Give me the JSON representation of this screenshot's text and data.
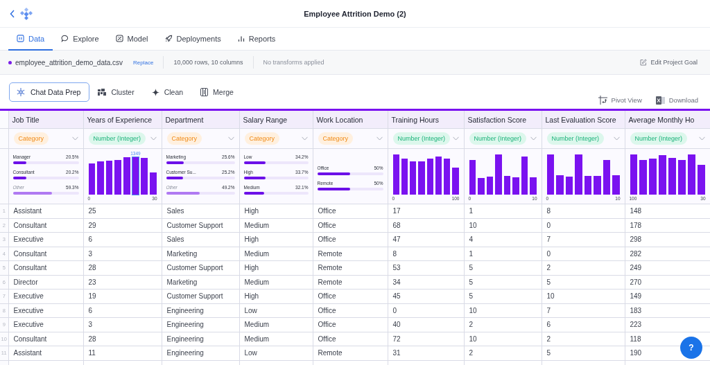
{
  "app": {
    "title": "Employee Attrition Demo (2)"
  },
  "tabs": [
    {
      "label": "Data",
      "kind": "data",
      "selected": true
    },
    {
      "label": "Explore",
      "kind": "chat",
      "selected": false
    },
    {
      "label": "Model",
      "kind": "model",
      "selected": false
    },
    {
      "label": "Deployments",
      "kind": "rocket",
      "selected": false
    },
    {
      "label": "Reports",
      "kind": "bars",
      "selected": false
    }
  ],
  "file_bar": {
    "file_name": "employee_attrition_demo_data.csv",
    "replace_link": "Replace",
    "stats": "10,000 rows, 10 columns",
    "transforms": "No transforms applied",
    "edit_goal": "Edit Project Goal"
  },
  "toolbar": {
    "left": [
      {
        "label": "Chat Data Prep",
        "kind": "snowflake",
        "selected": true
      },
      {
        "label": "Cluster",
        "kind": "cluster",
        "selected": false
      },
      {
        "label": "Clean",
        "kind": "sparkle",
        "selected": false
      },
      {
        "label": "Merge",
        "kind": "merge",
        "selected": false
      }
    ],
    "right": [
      {
        "label": "Pivot View",
        "kind": "pivot"
      },
      {
        "label": "Download",
        "kind": "sheet"
      }
    ]
  },
  "table": {
    "columns": [
      {
        "name": "Job Title",
        "type": {
          "kind": "category",
          "label": "Category"
        },
        "summary": {
          "kind": "category",
          "items": [
            {
              "label": "Manager",
              "percent": "20.5%",
              "level": 0.205,
              "kind": "value"
            },
            {
              "label": "Consultant",
              "percent": "20.2%",
              "level": 0.202,
              "kind": "value"
            },
            {
              "label": "Other",
              "percent": "59.3%",
              "level": 0.593,
              "kind": "other"
            }
          ]
        }
      },
      {
        "name": "Years of Experience",
        "type": {
          "kind": "number",
          "label": "Number (Integer)"
        },
        "summary": {
          "kind": "histogram",
          "min_label": "0",
          "max_label": "30",
          "tooltip": "1349",
          "bars": [
            {
              "selected": false
            },
            {
              "selected": false
            },
            {
              "selected": false
            },
            {
              "selected": false
            },
            {
              "selected": false
            },
            {
              "selected": true
            },
            {
              "selected": false
            },
            {
              "selected": false
            }
          ]
        }
      },
      {
        "name": "Department",
        "type": {
          "kind": "category",
          "label": "Category"
        },
        "summary": {
          "kind": "category",
          "items": [
            {
              "label": "Marketing",
              "percent": "25.6%",
              "level": 0.256,
              "kind": "value"
            },
            {
              "label": "Customer Su...",
              "percent": "25.2%",
              "level": 0.252,
              "kind": "value"
            },
            {
              "label": "Other",
              "percent": "49.2%",
              "level": 0.492,
              "kind": "other"
            }
          ]
        }
      },
      {
        "name": "Salary Range",
        "type": {
          "kind": "category",
          "label": "Category"
        },
        "summary": {
          "kind": "category",
          "items": [
            {
              "label": "Low",
              "percent": "34.2%",
              "level": 0.342,
              "kind": "value"
            },
            {
              "label": "High",
              "percent": "33.7%",
              "level": 0.337,
              "kind": "value"
            },
            {
              "label": "Medium",
              "percent": "32.1%",
              "level": 0.321,
              "kind": "value"
            }
          ]
        }
      },
      {
        "name": "Work Location",
        "type": {
          "kind": "category",
          "label": "Category"
        },
        "summary": {
          "kind": "category",
          "items": [
            {
              "label": "Office",
              "percent": "50%",
              "level": 0.5,
              "kind": "value"
            },
            {
              "label": "Remote",
              "percent": "50%",
              "level": 0.5,
              "kind": "value"
            }
          ]
        }
      },
      {
        "name": "Training Hours",
        "type": {
          "kind": "number",
          "label": "Number (Integer)"
        },
        "summary": {
          "kind": "histogram",
          "min_label": "0",
          "max_label": "100",
          "bars": [
            {
              "selected": false
            },
            {
              "selected": false
            },
            {
              "selected": false
            },
            {
              "selected": false
            },
            {
              "selected": false
            },
            {
              "selected": false
            },
            {
              "selected": false
            },
            {
              "selected": false
            }
          ]
        }
      },
      {
        "name": "Satisfaction Score",
        "type": {
          "kind": "number",
          "label": "Number (Integer)"
        },
        "summary": {
          "kind": "histogram",
          "min_label": "0",
          "max_label": "10",
          "bars": [
            {
              "selected": false
            },
            {
              "selected": false
            },
            {
              "selected": false
            },
            {
              "selected": false
            },
            {
              "selected": false
            },
            {
              "selected": false
            },
            {
              "selected": false
            },
            {
              "selected": false
            }
          ]
        }
      },
      {
        "name": "Last Evaluation Score",
        "type": {
          "kind": "number",
          "label": "Number (Integer)"
        },
        "summary": {
          "kind": "histogram",
          "min_label": "0",
          "max_label": "10",
          "bars": [
            {
              "selected": false
            },
            {
              "selected": false
            },
            {
              "selected": false
            },
            {
              "selected": false
            },
            {
              "selected": false
            },
            {
              "selected": false
            },
            {
              "selected": false
            },
            {
              "selected": false
            }
          ]
        }
      },
      {
        "name": "Average Monthly Ho",
        "type": {
          "kind": "number",
          "label": "Number (Integer)"
        },
        "summary": {
          "kind": "histogram",
          "min_label": "100",
          "max_label": "30",
          "bars": [
            {
              "selected": false
            },
            {
              "selected": false
            },
            {
              "selected": false
            },
            {
              "selected": false
            },
            {
              "selected": false
            },
            {
              "selected": false
            },
            {
              "selected": false
            },
            {
              "selected": false
            }
          ]
        }
      }
    ],
    "rows": [
      {
        "number": "1",
        "cells": [
          "Assistant",
          "25",
          "Sales",
          "High",
          "Office",
          "17",
          "1",
          "8",
          "148"
        ]
      },
      {
        "number": "2",
        "cells": [
          "Consultant",
          "29",
          "Customer Support",
          "Medium",
          "Office",
          "68",
          "10",
          "0",
          "178"
        ]
      },
      {
        "number": "3",
        "cells": [
          "Executive",
          "6",
          "Sales",
          "High",
          "Office",
          "47",
          "4",
          "7",
          "298"
        ]
      },
      {
        "number": "4",
        "cells": [
          "Consultant",
          "3",
          "Marketing",
          "Medium",
          "Remote",
          "8",
          "1",
          "0",
          "282"
        ]
      },
      {
        "number": "5",
        "cells": [
          "Consultant",
          "28",
          "Customer Support",
          "High",
          "Remote",
          "53",
          "5",
          "2",
          "249"
        ]
      },
      {
        "number": "6",
        "cells": [
          "Director",
          "23",
          "Marketing",
          "Medium",
          "Remote",
          "34",
          "5",
          "5",
          "270"
        ]
      },
      {
        "number": "7",
        "cells": [
          "Executive",
          "19",
          "Customer Support",
          "High",
          "Office",
          "45",
          "5",
          "10",
          "149"
        ]
      },
      {
        "number": "8",
        "cells": [
          "Executive",
          "6",
          "Engineering",
          "Low",
          "Office",
          "0",
          "10",
          "7",
          "183"
        ]
      },
      {
        "number": "9",
        "cells": [
          "Executive",
          "3",
          "Engineering",
          "Medium",
          "Office",
          "40",
          "2",
          "6",
          "223"
        ]
      },
      {
        "number": "10",
        "cells": [
          "Consultant",
          "28",
          "Engineering",
          "Medium",
          "Office",
          "72",
          "10",
          "2",
          "118"
        ]
      },
      {
        "number": "11",
        "cells": [
          "Assistant",
          "11",
          "Engineering",
          "Low",
          "Remote",
          "31",
          "2",
          "5",
          "190"
        ]
      }
    ]
  },
  "help_button": "?"
}
